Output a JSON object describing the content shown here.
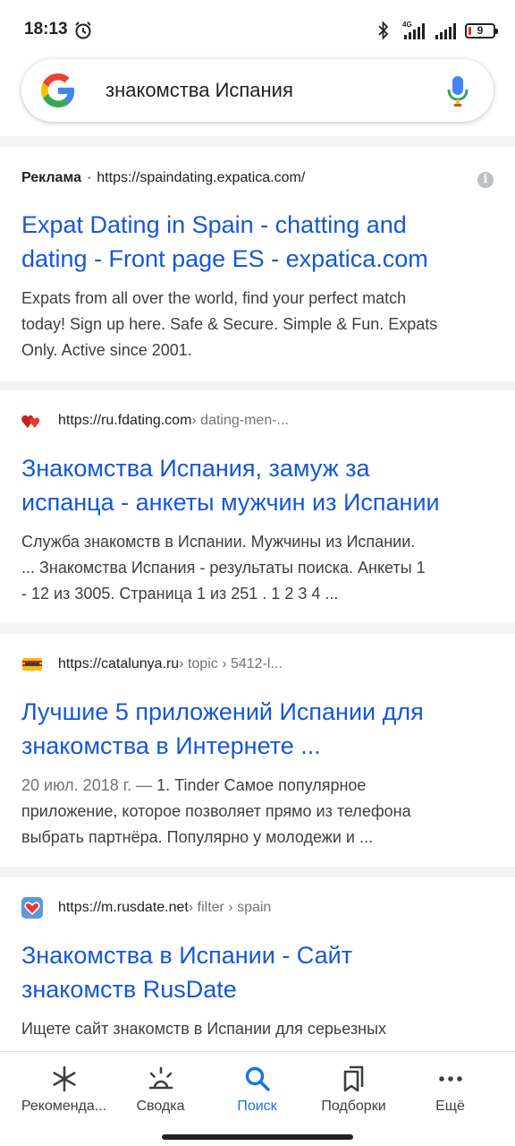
{
  "status_bar": {
    "time": "18:13",
    "network": "4G",
    "battery": "9",
    "icons": [
      "alarm-icon",
      "bluetooth-icon",
      "signal-icon",
      "signal-icon",
      "battery-icon"
    ]
  },
  "search": {
    "query": "знакомства Испания",
    "logo": "google-g-icon",
    "voice": "mic-icon"
  },
  "results": [
    {
      "ad_label": "Реклама",
      "ad_dot": "·",
      "url": "https://spaindating.expatica.com/",
      "info": "i",
      "title_line1": "Expat Dating in Spain - chatting and",
      "title_line2": "dating - Front page ES - expatica.com",
      "snippet_line1": "Expats from all over the world, find your perfect match",
      "snippet_line2": "today! Sign up here. Safe & Secure. Simple & Fun. Expats",
      "snippet_line3": "Only. Active since 2001."
    },
    {
      "url": "https://ru.fdating.com",
      "path": " › dating-men-...",
      "title_line1": "Знакомства Испания, замуж за",
      "title_line2": "испанца - анкеты мужчин из Испании",
      "snippet_line1": "Служба знакомств в Испании. Мужчины из Испании.",
      "snippet_line2": "... Знакомства Испания - результаты поиска. Анкеты 1",
      "snippet_line3": "- 12 из 3005. Страница 1 из 251 . 1 2 3 4 ..."
    },
    {
      "url": "https://catalunya.ru",
      "path": " › topic › 5412-l...",
      "title_line1": "Лучшие 5 приложений Испании для",
      "title_line2": "знакомства в Интернете ...",
      "snippet_date": "20 июл. 2018 г. — ",
      "snippet_line1": "1. Tinder Самое популярное",
      "snippet_line2": "приложение, которое позволяет прямо из телефона",
      "snippet_line3": "выбрать партнёра. Популярно у молодежи и ..."
    },
    {
      "url": "https://m.rusdate.net",
      "path": " › filter › spain",
      "title_line1": "Знакомства в Испании - Сайт",
      "title_line2": "знакомств RusDate",
      "snippet_line1": "Ищете сайт знакомств в Испании для серьезных"
    }
  ],
  "bottom_nav": [
    {
      "label": "Рекоменда...",
      "icon": "asterisk-icon"
    },
    {
      "label": "Сводка",
      "icon": "sunrise-icon"
    },
    {
      "label": "Поиск",
      "icon": "search-icon"
    },
    {
      "label": "Подборки",
      "icon": "collections-icon"
    },
    {
      "label": "Ещё",
      "icon": "more-dots-icon"
    }
  ],
  "colors": {
    "link": "#1558d6",
    "active_tab": "#1a73e8",
    "divider": "#f1f3f4"
  }
}
